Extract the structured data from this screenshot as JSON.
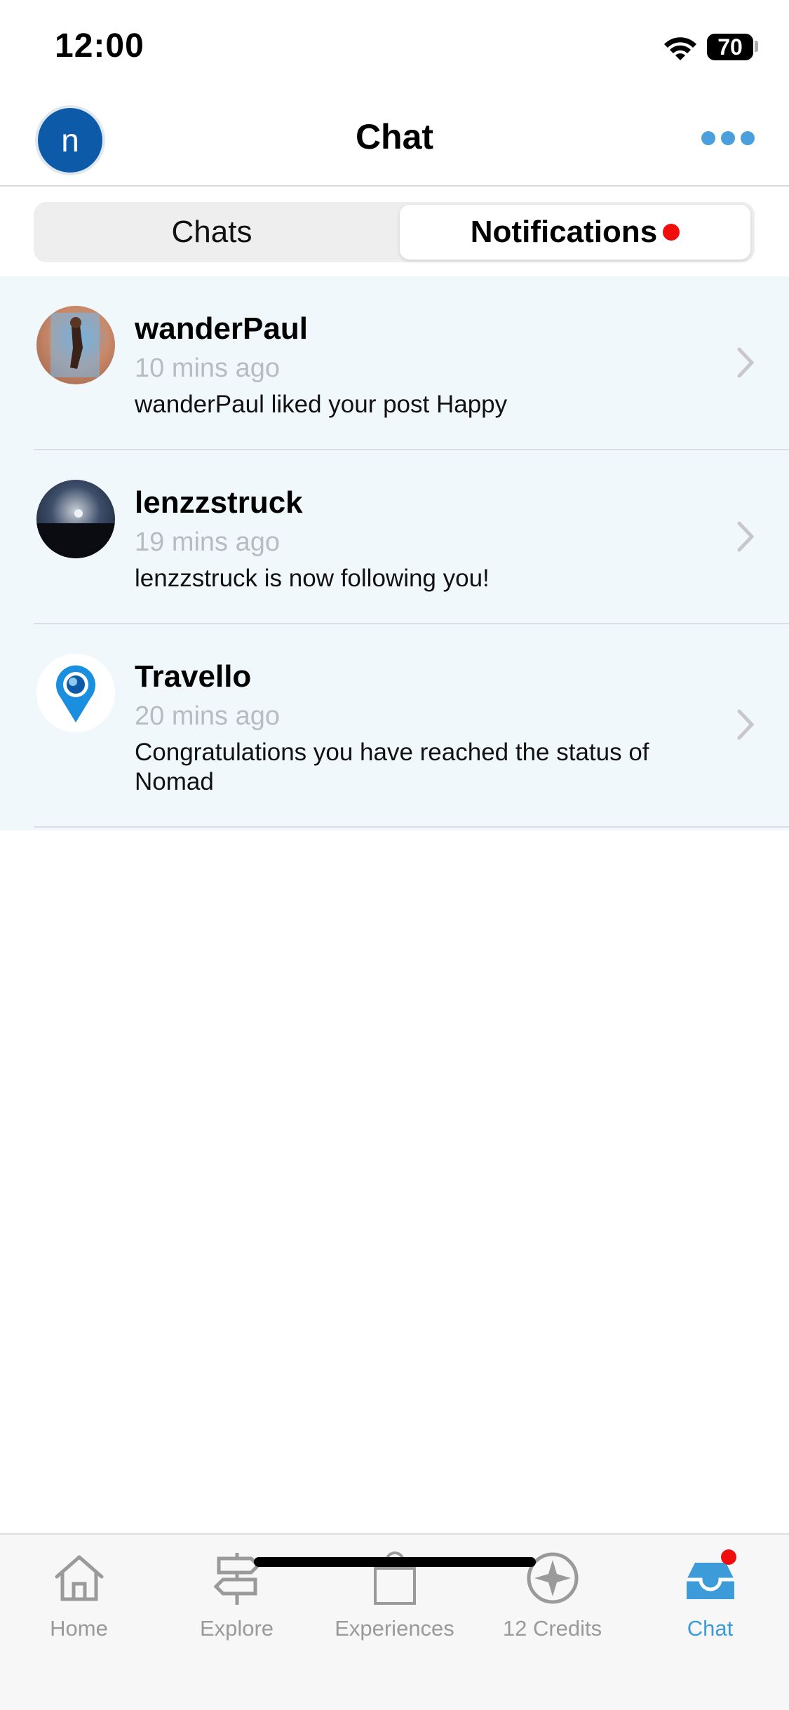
{
  "status_bar": {
    "time": "12:00",
    "battery": "70"
  },
  "header": {
    "avatar_letter": "n",
    "title": "Chat"
  },
  "segments": {
    "chats": "Chats",
    "notifications": "Notifications"
  },
  "notifications": [
    {
      "name": "wanderPaul",
      "time": "10 mins ago",
      "text": "wanderPaul liked your post Happy"
    },
    {
      "name": "lenzzstruck",
      "time": "19 mins ago",
      "text": "lenzzstruck is now following you!"
    },
    {
      "name": "Travello",
      "time": "20 mins ago",
      "text": "Congratulations you have reached the status of Nomad"
    }
  ],
  "tabs": [
    {
      "label": "Home",
      "icon": "home-icon"
    },
    {
      "label": "Explore",
      "icon": "signpost-icon"
    },
    {
      "label": "Experiences",
      "icon": "shopping-bag-icon"
    },
    {
      "label": "12 Credits",
      "icon": "compass-star-icon"
    },
    {
      "label": "Chat",
      "icon": "inbox-icon"
    }
  ],
  "colors": {
    "accent": "#3c9bd8",
    "notification_bg": "#f1f8fc",
    "badge": "#f20d0d",
    "avatar_bg": "#0d5aa8"
  }
}
